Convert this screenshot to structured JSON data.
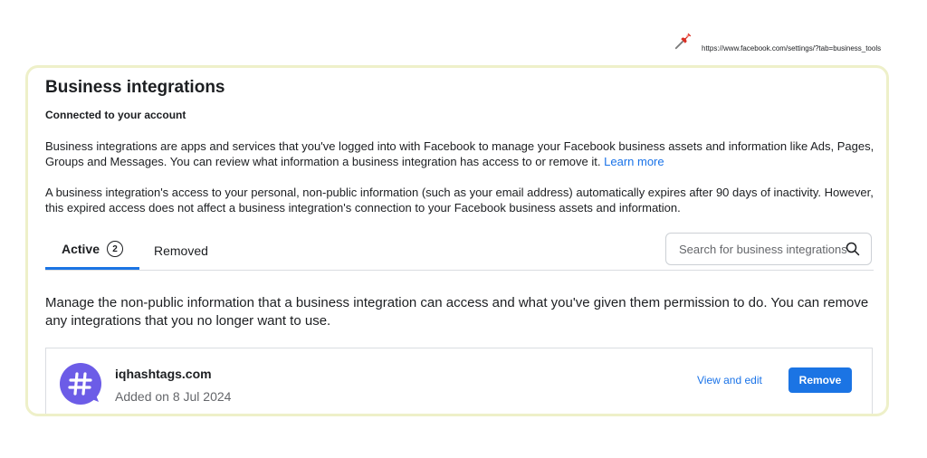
{
  "browser": {
    "url": "https://www.facebook.com/settings/?tab=business_tools",
    "pin_icon": "pushpin-icon"
  },
  "page": {
    "title": "Business integrations",
    "subtitle": "Connected to your account",
    "paragraph1_text": "Business integrations are apps and services that you've logged into with Facebook to manage your Facebook business assets and information like Ads, Pages, Groups and Messages. You can review what information a business integration has access to or remove it.",
    "paragraph1_link": "Learn more",
    "paragraph2_text": "A business integration's access to your personal, non-public information (such as your email address) automatically expires after 90 days of inactivity. However, this expired access does not affect a business integration's connection to your Facebook business assets and information."
  },
  "tabs": {
    "active_label": "Active",
    "active_count": "2",
    "removed_label": "Removed"
  },
  "search": {
    "placeholder": "Search for business integrations",
    "icon": "search-icon"
  },
  "description": "Manage the non-public information that a business integration can access and what you've given them permission to do. You can remove any integrations that you no longer want to use.",
  "integrations": [
    {
      "name": "iqhashtags.com",
      "added": "Added on 8 Jul 2024",
      "avatar_icon": "hashtag-icon",
      "view_edit_label": "View and edit",
      "remove_label": "Remove"
    }
  ],
  "colors": {
    "accent": "#1b74e4",
    "link": "#1a73e8",
    "card_border": "#eef0c9",
    "avatar_bg": "#6c5ce7"
  }
}
